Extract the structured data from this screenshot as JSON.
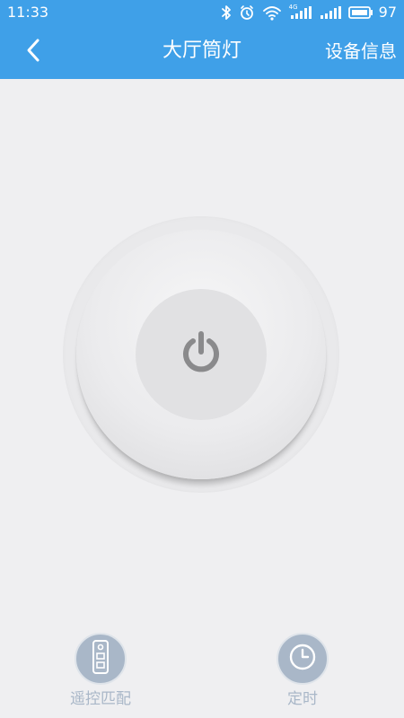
{
  "status_bar": {
    "time": "11:33",
    "network_label": "4G",
    "battery_percent": "97"
  },
  "navbar": {
    "title": "大厅筒灯",
    "right_action": "设备信息"
  },
  "colors": {
    "header_bg": "#3fa0e8",
    "page_bg": "#efeff1",
    "power_icon": "#8a8a8c",
    "bottom_button": "#a9b7c8"
  },
  "main": {
    "power_icon": "power-icon"
  },
  "bottom_actions": [
    {
      "label": "遥控匹配",
      "icon": "remote-icon"
    },
    {
      "label": "定时",
      "icon": "clock-icon"
    }
  ]
}
